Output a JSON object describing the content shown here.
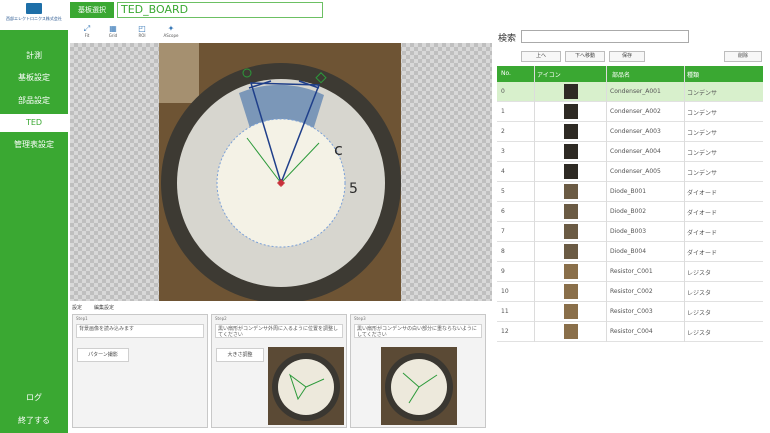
{
  "sidebar": {
    "logo_text": "西部エレクトロニクス株式会社",
    "items": [
      {
        "label": "計測",
        "active": false
      },
      {
        "label": "基板設定",
        "active": false
      },
      {
        "label": "部品設定",
        "active": false
      },
      {
        "label": "TED",
        "active": true
      },
      {
        "label": "管理表設定",
        "active": false
      }
    ],
    "footer": [
      {
        "label": "ログ"
      },
      {
        "label": "終了する"
      }
    ]
  },
  "header": {
    "board_select_label": "基板選択",
    "board_name": "TED_BOARD"
  },
  "toolbar": [
    {
      "label": "Fit",
      "icon": "fit-icon"
    },
    {
      "label": "Grid",
      "icon": "grid-icon"
    },
    {
      "label": "ROI",
      "icon": "roi-icon"
    },
    {
      "label": "AScope",
      "icon": "scope-icon"
    }
  ],
  "bottom_tabs": [
    {
      "label": "設定"
    },
    {
      "label": "編集設定"
    }
  ],
  "steps": [
    {
      "title": "Step1",
      "desc": "背景画像を読み込みます",
      "button": "パターン撮影"
    },
    {
      "title": "Step2",
      "desc": "黒い扇形がコンデンサ外周に入るように位置を調整してください",
      "button": "大きさ調整"
    },
    {
      "title": "Step3",
      "desc": "黒い扇形がコンデンサの白い部分に重ならないようにしてください",
      "button": ""
    }
  ],
  "search": {
    "label": "検索"
  },
  "actions": {
    "up": "上へ",
    "down": "下へ移動",
    "save": "保存",
    "delete": "削除"
  },
  "table": {
    "headers": [
      "No.",
      "アイコン",
      "部品名",
      "種類"
    ],
    "rows": [
      {
        "no": "0",
        "name": "Condenser_A001",
        "type": "コンデンサ"
      },
      {
        "no": "1",
        "name": "Condenser_A002",
        "type": "コンデンサ"
      },
      {
        "no": "2",
        "name": "Condenser_A003",
        "type": "コンデンサ"
      },
      {
        "no": "3",
        "name": "Condenser_A004",
        "type": "コンデンサ"
      },
      {
        "no": "4",
        "name": "Condenser_A005",
        "type": "コンデンサ"
      },
      {
        "no": "5",
        "name": "Diode_B001",
        "type": "ダイオード"
      },
      {
        "no": "6",
        "name": "Diode_B002",
        "type": "ダイオード"
      },
      {
        "no": "7",
        "name": "Diode_B003",
        "type": "ダイオード"
      },
      {
        "no": "8",
        "name": "Diode_B004",
        "type": "ダイオード"
      },
      {
        "no": "9",
        "name": "Resistor_C001",
        "type": "レジスタ"
      },
      {
        "no": "10",
        "name": "Resistor_C002",
        "type": "レジスタ"
      },
      {
        "no": "11",
        "name": "Resistor_C003",
        "type": "レジスタ"
      },
      {
        "no": "12",
        "name": "Resistor_C004",
        "type": "レジスタ"
      }
    ]
  },
  "colors": {
    "accent": "#3aa832",
    "selected_row": "#d8f0cc"
  }
}
